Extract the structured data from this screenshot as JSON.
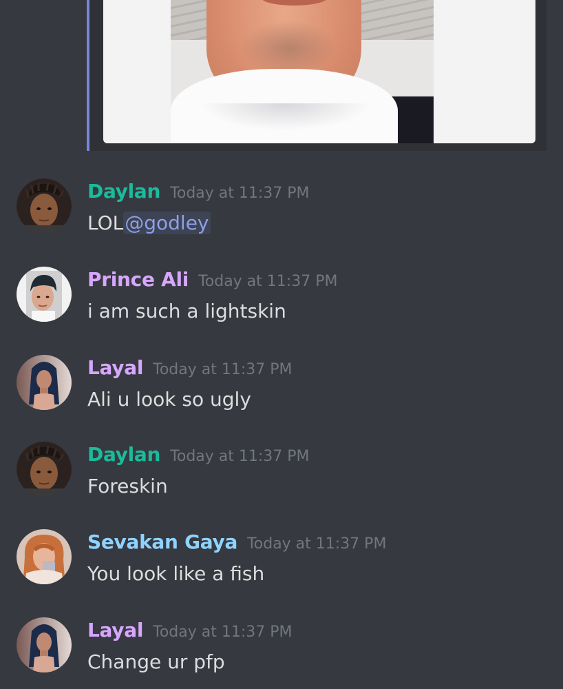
{
  "colors": {
    "background": "#36393f",
    "embed_border": "#7289da",
    "timestamp": "#72767d",
    "message_text": "#dcddde",
    "mention": "#8da0e6"
  },
  "embed": {
    "kind": "image-attachment",
    "icon": "photo-of-person"
  },
  "messages": [
    {
      "author": "Daylan",
      "author_color": "#1abc9c",
      "timestamp": "Today at 11:37 PM",
      "text": "LOL",
      "mention": "@godley",
      "avatar": "avatar-daylan"
    },
    {
      "author": "Prince Ali",
      "author_color": "#d7a6ff",
      "timestamp": "Today at 11:37 PM",
      "text": "i am such a lightskin",
      "avatar": "avatar-prince-ali"
    },
    {
      "author": "Layal",
      "author_color": "#d7a6ff",
      "timestamp": "Today at 11:37 PM",
      "text": "Ali u look so ugly",
      "avatar": "avatar-layal"
    },
    {
      "author": "Daylan",
      "author_color": "#1abc9c",
      "timestamp": "Today at 11:37 PM",
      "text": "Foreskin",
      "avatar": "avatar-daylan"
    },
    {
      "author": "Sevakan Gaya",
      "author_color": "#8fd3ff",
      "timestamp": "Today at 11:37 PM",
      "text": "You look like a fish",
      "avatar": "avatar-sevakan"
    },
    {
      "author": "Layal",
      "author_color": "#d7a6ff",
      "timestamp": "Today at 11:37 PM",
      "text": "Change ur pfp",
      "avatar": "avatar-layal"
    }
  ]
}
